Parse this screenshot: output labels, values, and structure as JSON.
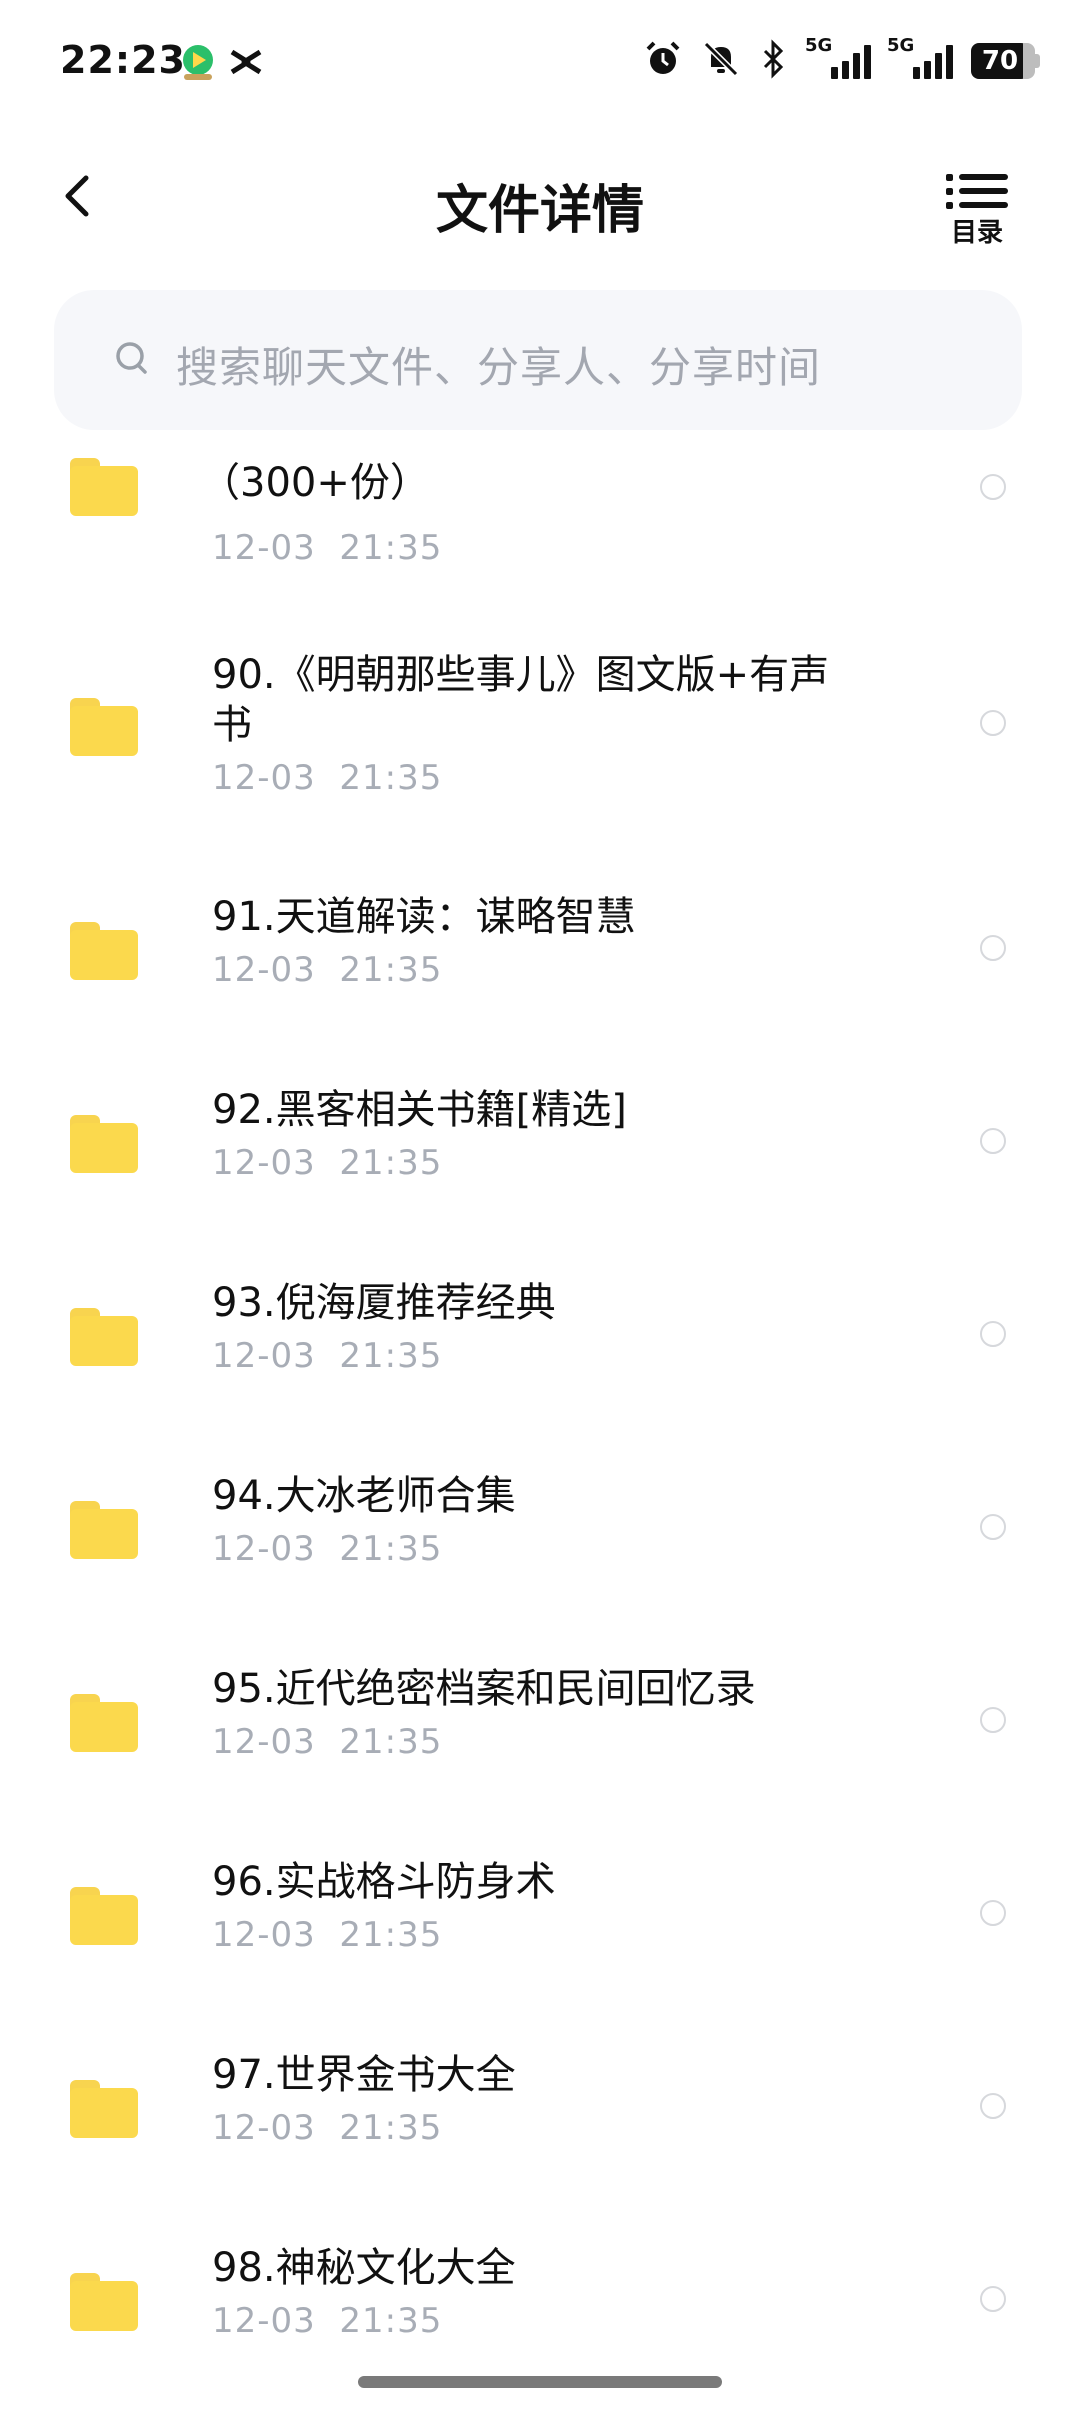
{
  "status_bar": {
    "time": "22:23",
    "icons": [
      "video-app-icon",
      "capcut-icon",
      "alarm-icon",
      "mute-icon",
      "bluetooth-icon",
      "signal-5g-icon",
      "signal-5g-icon"
    ],
    "network_label_1": "5G",
    "network_label_2": "5G",
    "battery": "70"
  },
  "header": {
    "title": "文件详情",
    "toc_label": "目录"
  },
  "search": {
    "placeholder": "搜索聊天文件、分享人、分享时间"
  },
  "files": [
    {
      "name": "（300+份）",
      "date": "12-03",
      "time": "21:35"
    },
    {
      "name": "90.《明朝那些事儿》图文版+有声书",
      "date": "12-03",
      "time": "21:35"
    },
    {
      "name": "91.天道解读：谋略智慧",
      "date": "12-03",
      "time": "21:35"
    },
    {
      "name": "92.黑客相关书籍[精选]",
      "date": "12-03",
      "time": "21:35"
    },
    {
      "name": "93.倪海厦推荐经典",
      "date": "12-03",
      "time": "21:35"
    },
    {
      "name": "94.大冰老师合集",
      "date": "12-03",
      "time": "21:35"
    },
    {
      "name": "95.近代绝密档案和民间回忆录",
      "date": "12-03",
      "time": "21:35"
    },
    {
      "name": "96.实战格斗防身术",
      "date": "12-03",
      "time": "21:35"
    },
    {
      "name": "97.世界金书大全",
      "date": "12-03",
      "time": "21:35"
    },
    {
      "name": "98.神秘文化大全",
      "date": "12-03",
      "time": "21:35"
    }
  ]
}
